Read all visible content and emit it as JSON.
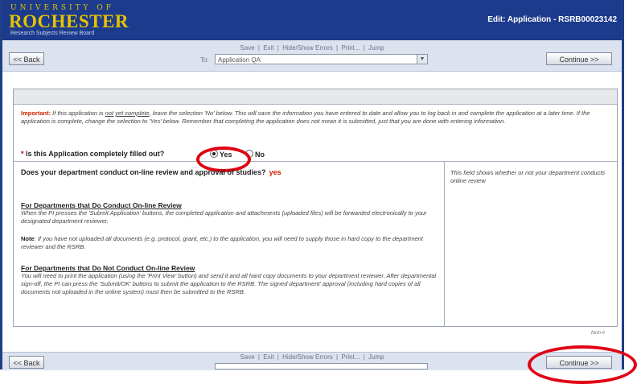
{
  "header": {
    "logo_top": "UNIVERSITY OF",
    "logo_main": "ROCHESTER",
    "logo_sub": "Research Subjects Review Board",
    "title": "Edit: Application - RSRB00023142"
  },
  "toolbar": {
    "back_label": "<< Back",
    "continue_label": "Continue >>",
    "links": [
      "Save",
      "|",
      "Exit",
      "|",
      "Hide/Show Errors",
      "|",
      "Print...",
      "|",
      "Jump"
    ],
    "to_label": "To:",
    "jump_selected": "Application QA"
  },
  "important": {
    "label": "Important:",
    "text_a": " If this application is ",
    "text_underline": "not yet complete",
    "text_b": ", leave the selection 'No' below.  This will save the information you have entered to date and allow you to log back in and complete the application at a later time.  If the application is complete, change the selection to 'Yes' below.   Remember that completing the application does not mean it is submitted, just that you are done with entering information.",
    "star": "*",
    "question": "Is this Application completely filled out?",
    "yes": "Yes",
    "no": "No"
  },
  "question": {
    "title": "Does your department conduct on-line review and approval of studies?",
    "answer": "yes",
    "help": "This field shows whether or not your department conducts online review",
    "section1_head": "For Departments that Do Conduct On-line Review",
    "section1_text": "When the PI presses the 'Submit Application' buttons, the completed application and attachments (uploaded files) will be forwarded electronically to your designated department reviewer.",
    "note_label": "Note",
    "note_text": ": If you have not uploaded all documents (e.g. protocol, grant, etc.) to the application, you will need to supply those in hard copy to the department reviewer and the RSRB.",
    "section2_head": "For Departments that Do Not Conduct On-line Review",
    "section2_text": "You will need to print the application (using the 'Print View' button) and send it and all hard copy documents to your department reviewer. After departmental sign-off, the PI can press the 'Submit/OK' buttons to submit the application to the RSRB. The signed department' approval (including hard copies of all documents not uploaded in the online system) must then be submitted to the RSRB."
  },
  "form_number": "form #",
  "bottom": {
    "back_label": "<< Back",
    "continue_label": "Continue >>",
    "links": [
      "Save",
      "|",
      "Exit",
      "|",
      "Hide/Show Errors",
      "|",
      "Print...",
      "|",
      "Jump"
    ]
  },
  "colors": {
    "banner": "#1c3b8c",
    "logo": "#e6c200",
    "highlight": "#e00012",
    "important": "#cc2200"
  }
}
